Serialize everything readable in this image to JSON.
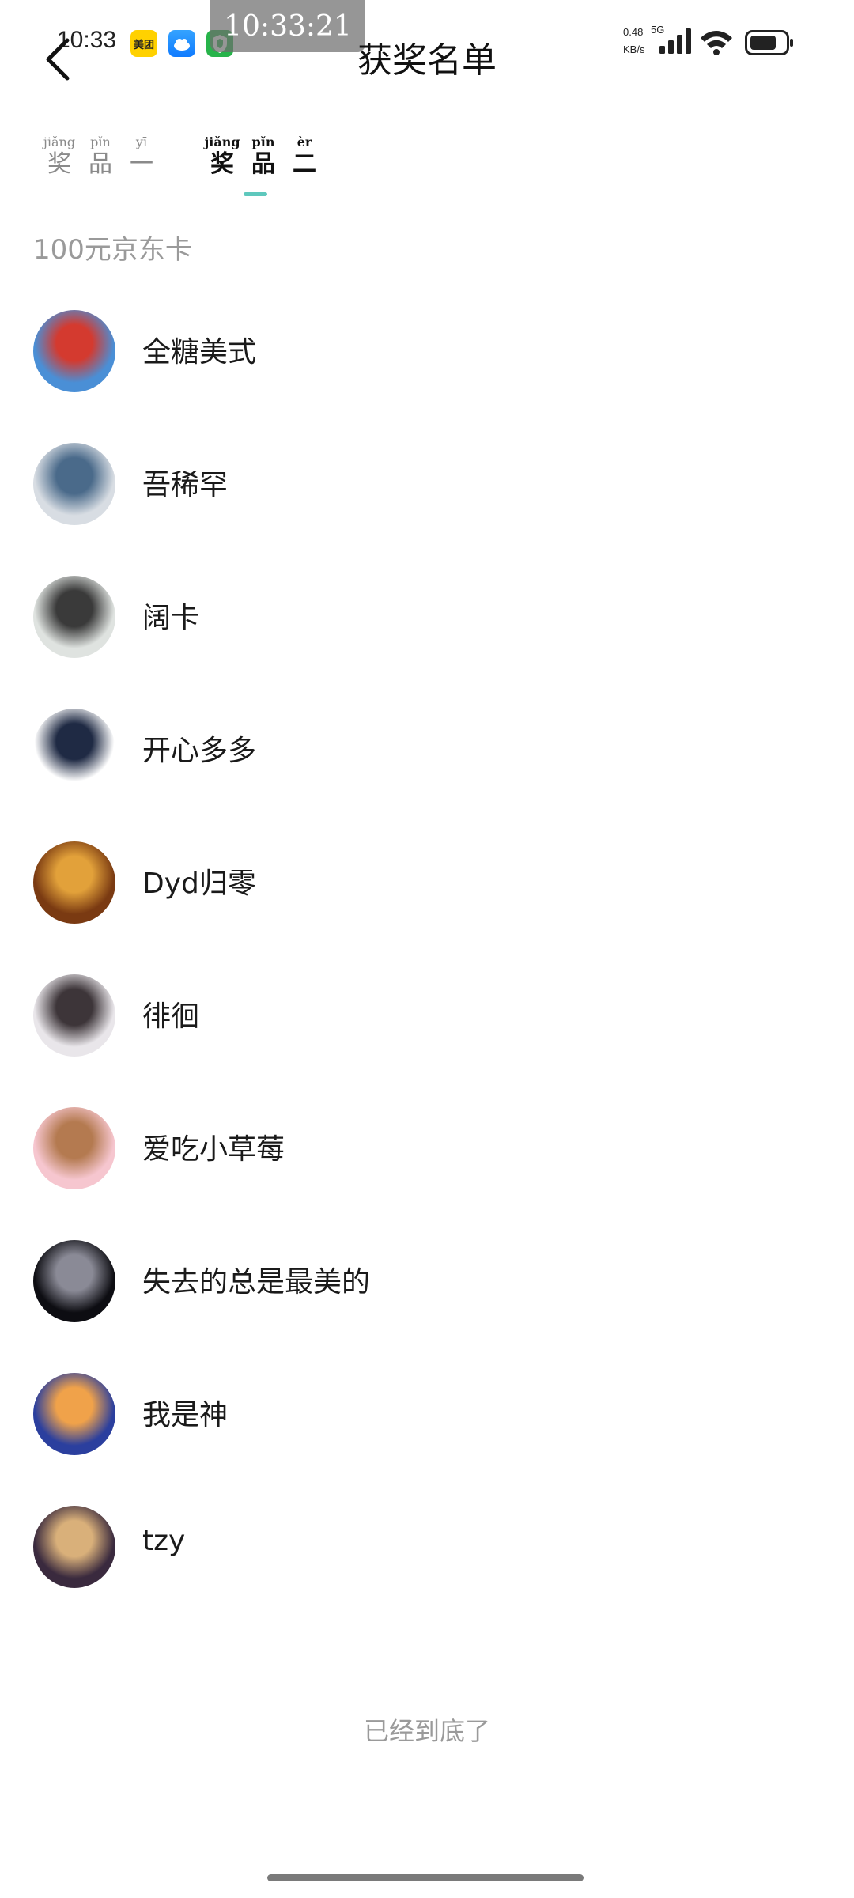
{
  "status_bar": {
    "time": "10:33",
    "clock_overlay": "10:33:21",
    "net_speed_value": "0.48",
    "net_speed_unit": "KB/s",
    "net_type": "5G",
    "apps": [
      {
        "name": "meituan",
        "label": "美团"
      },
      {
        "name": "weather-app",
        "label": ""
      },
      {
        "name": "security-app",
        "label": ""
      }
    ]
  },
  "header": {
    "title": "获奖名单"
  },
  "tabs": [
    {
      "active": false,
      "chars": [
        {
          "pinyin": "jiǎng",
          "hanzi": "奖"
        },
        {
          "pinyin": "pǐn",
          "hanzi": "品"
        },
        {
          "pinyin": "yī",
          "hanzi": "一"
        }
      ]
    },
    {
      "active": true,
      "chars": [
        {
          "pinyin": "jiǎng",
          "hanzi": "奖"
        },
        {
          "pinyin": "pǐn",
          "hanzi": "品"
        },
        {
          "pinyin": "èr",
          "hanzi": "二"
        }
      ]
    }
  ],
  "accent_color": "#5ec8bd",
  "prize": {
    "heading": "100元京东卡"
  },
  "winners": [
    {
      "name": "全糖美式",
      "avatar_colors": [
        "#4a8fd6",
        "#d43a2f"
      ]
    },
    {
      "name": "吾稀罕",
      "avatar_colors": [
        "#d8dde3",
        "#4a6a8a"
      ]
    },
    {
      "name": "阔卡",
      "avatar_colors": [
        "#dfe3e0",
        "#3a3a3a"
      ]
    },
    {
      "name": "开心多多",
      "avatar_colors": [
        "#ffffff",
        "#1f2a44"
      ]
    },
    {
      "name": "Dyd归零",
      "avatar_colors": [
        "#7a3a12",
        "#e2a13a"
      ]
    },
    {
      "name": "徘徊",
      "avatar_colors": [
        "#e9e6ea",
        "#3d3539"
      ]
    },
    {
      "name": "爱吃小草莓",
      "avatar_colors": [
        "#f6c6cf",
        "#b47a50"
      ]
    },
    {
      "name": "失去的总是最美的",
      "avatar_colors": [
        "#0d0d12",
        "#8a8a96"
      ]
    },
    {
      "name": "我是神",
      "avatar_colors": [
        "#2b3f9e",
        "#f0a24a"
      ]
    },
    {
      "name": "tzy",
      "avatar_colors": [
        "#3a2a3e",
        "#d9b07a"
      ]
    }
  ],
  "footer": {
    "end_text": "已经到底了"
  }
}
